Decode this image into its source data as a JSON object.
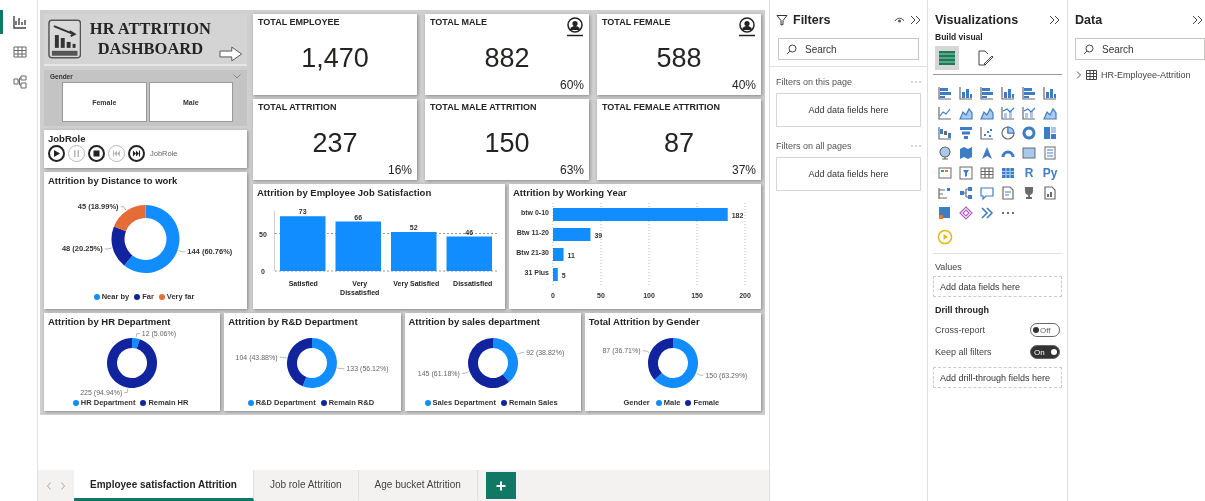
{
  "rail": [
    {
      "kind": "report",
      "selected": true
    },
    {
      "kind": "table",
      "selected": false
    },
    {
      "kind": "model",
      "selected": false
    }
  ],
  "report": {
    "title": "HR ATTRITION DASHBOARD",
    "gender_slicer": {
      "title": "Gender",
      "options": [
        {
          "label": "Female",
          "selected": false
        },
        {
          "label": "Male",
          "selected": false
        }
      ]
    },
    "jobrole_player": {
      "title": "JobRole",
      "label": "JobRole",
      "controls": [
        {
          "kind": "play",
          "disabled": false
        },
        {
          "kind": "pause",
          "disabled": true
        },
        {
          "kind": "stop",
          "disabled": false
        },
        {
          "kind": "previous",
          "disabled": true
        },
        {
          "kind": "next",
          "disabled": false
        }
      ]
    },
    "kpis": [
      {
        "title": "TOTAL EMPLOYEE",
        "value": "1,470",
        "person_icon": false
      },
      {
        "title": "TOTAL MALE",
        "value": "882",
        "share": "60%",
        "person_icon": true
      },
      {
        "title": "TOTAL FEMALE",
        "value": "588",
        "share": "40%",
        "person_icon": true
      },
      {
        "title": "TOTAL ATTRITION",
        "value": "237",
        "share": "16%",
        "person_icon": false
      },
      {
        "title": "TOTAL MALE ATTRITION",
        "value": "150",
        "share": "63%",
        "person_icon": false
      },
      {
        "title": "TOTAL FEMALE ATTRITION",
        "value": "87",
        "share": "37%",
        "person_icon": false
      }
    ],
    "distance_chart": {
      "chart_data": {
        "type": "donut",
        "title": "Attrition by Distance to work",
        "categories": [
          "Near by",
          "Far",
          "Very far"
        ],
        "values": [
          144,
          48,
          45
        ],
        "colors": [
          "#118dff",
          "#12239e",
          "#e66c37"
        ],
        "value_labels": [
          "144 (60.76%)",
          "48 (20.25%)",
          "45 (18.99%)"
        ],
        "legend": "bottom"
      }
    },
    "satisfaction_chart": {
      "chart_data": {
        "type": "bar",
        "title": "Attrition by Employee Job Satisfaction",
        "categories": [
          "Satisfied",
          "Very Dissatisfied",
          "Very Satisfied",
          "Dissatisfied"
        ],
        "series": [
          {
            "color": "#118dff",
            "values": [
              73,
              66,
              52,
              46
            ]
          }
        ],
        "ylim": [
          0,
          80
        ],
        "yticks": [
          0,
          50
        ],
        "grid": true,
        "data_labels": true
      }
    },
    "working_year_chart": {
      "chart_data": {
        "type": "bar",
        "orientation": "horizontal",
        "title": "Attrition by Working Year",
        "categories": [
          "btw 0-10",
          "Btw 11-20",
          "Btw 21-30",
          "31 Plus"
        ],
        "series": [
          {
            "color": "#118dff",
            "values": [
              182,
              39,
              11,
              5
            ]
          }
        ],
        "xlim": [
          0,
          200
        ],
        "xticks": [
          0,
          50,
          100,
          150,
          200
        ],
        "grid": true,
        "data_labels": true
      }
    },
    "department_charts": [
      {
        "chart_data": {
          "type": "donut",
          "title": "Attrition by HR Department",
          "categories": [
            "HR Department",
            "Remain HR"
          ],
          "values": [
            12,
            225
          ],
          "colors": [
            "#118dff",
            "#12239e"
          ],
          "value_labels": [
            "12 (5.06%)",
            "225 (94.94%)"
          ],
          "legend": "bottom"
        }
      },
      {
        "chart_data": {
          "type": "donut",
          "title": "Attrition by R&D Department",
          "categories": [
            "R&D Department",
            "Remain R&D"
          ],
          "values": [
            133,
            104
          ],
          "colors": [
            "#118dff",
            "#12239e"
          ],
          "value_labels": [
            "133 (56.12%)",
            "104 (43.88%)"
          ],
          "legend": "bottom"
        }
      },
      {
        "chart_data": {
          "type": "donut",
          "title": "Attrition by sales department",
          "categories": [
            "Sales Department",
            "Remain Sales"
          ],
          "values": [
            92,
            145
          ],
          "colors": [
            "#118dff",
            "#12239e"
          ],
          "value_labels": [
            "92 (38.82%)",
            "145 (61.18%)"
          ],
          "legend": "bottom"
        }
      },
      {
        "chart_data": {
          "type": "donut",
          "title": "Total Attrition by Gender",
          "legend_title": "Gender",
          "categories": [
            "Male",
            "Female"
          ],
          "values": [
            150,
            87
          ],
          "colors": [
            "#118dff",
            "#12239e"
          ],
          "value_labels": [
            "150 (63.29%)",
            "87 (36.71%)"
          ],
          "legend": "bottom"
        }
      }
    ]
  },
  "page_tabs": [
    {
      "label": "Employee satisfaction Attrition",
      "selected": true
    },
    {
      "label": "Job role Attrition",
      "selected": false
    },
    {
      "label": "Age bucket Attrition",
      "selected": false
    }
  ],
  "filters": {
    "title": "Filters",
    "search": {
      "placeholder": "Search"
    },
    "sections": [
      {
        "title": "Filters on this page",
        "drop_hint": "Add data fields here"
      },
      {
        "title": "Filters on all pages",
        "drop_hint": "Add data fields here"
      }
    ]
  },
  "visualizations": {
    "title": "Visualizations",
    "subtitle": "Build visual",
    "modes": [
      {
        "kind": "build",
        "selected": true
      },
      {
        "kind": "format",
        "selected": false
      }
    ],
    "visual_types": [
      {
        "kind": "bar-h"
      },
      {
        "kind": "bar-v"
      },
      {
        "kind": "bar-h"
      },
      {
        "kind": "bar-v"
      },
      {
        "kind": "bar-h"
      },
      {
        "kind": "bar-v"
      },
      {
        "kind": "line"
      },
      {
        "kind": "area"
      },
      {
        "kind": "area"
      },
      {
        "kind": "combo"
      },
      {
        "kind": "combo"
      },
      {
        "kind": "area"
      },
      {
        "kind": "waterfall"
      },
      {
        "kind": "funnel"
      },
      {
        "kind": "scatter"
      },
      {
        "kind": "pie"
      },
      {
        "kind": "donut"
      },
      {
        "kind": "treemap"
      },
      {
        "kind": "globe"
      },
      {
        "kind": "map"
      },
      {
        "kind": "arrow"
      },
      {
        "kind": "gauge"
      },
      {
        "kind": "card"
      },
      {
        "kind": "list"
      },
      {
        "kind": "kpi"
      },
      {
        "kind": "slicer"
      },
      {
        "kind": "table"
      },
      {
        "kind": "matrix"
      },
      {
        "kind": "text",
        "label": "R"
      },
      {
        "kind": "text",
        "label": "Py"
      },
      {
        "kind": "influencers"
      },
      {
        "kind": "decomp"
      },
      {
        "kind": "chat"
      },
      {
        "kind": "narrative"
      },
      {
        "kind": "trophy"
      },
      {
        "kind": "paginated"
      },
      {
        "kind": "apps"
      },
      {
        "kind": "diamond"
      },
      {
        "kind": "automate"
      },
      {
        "kind": "more"
      }
    ],
    "extra_visuals": [
      {
        "kind": "play"
      }
    ],
    "wells": [
      {
        "title": "Values",
        "drop_hint": "Add data fields here"
      }
    ],
    "drill_through": {
      "title": "Drill through",
      "toggles": [
        {
          "label": "Cross-report",
          "on": false,
          "state_text": "Off"
        },
        {
          "label": "Keep all filters",
          "on": true,
          "state_text": "On"
        }
      ],
      "drop_hint": "Add drill-through fields here"
    }
  },
  "data_pane": {
    "title": "Data",
    "search": {
      "placeholder": "Search"
    },
    "tables": [
      {
        "name": "HR-Employee-Attrition",
        "expanded": false
      }
    ]
  }
}
